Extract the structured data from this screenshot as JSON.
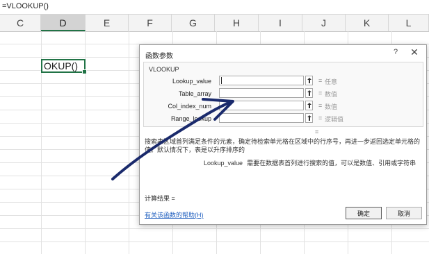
{
  "formula_bar": {
    "text": "=VLOOKUP()"
  },
  "columns": [
    "C",
    "D",
    "E",
    "F",
    "G",
    "H",
    "I",
    "J",
    "K",
    "L"
  ],
  "selected_column": "D",
  "active_cell": {
    "text": "OKUP()"
  },
  "dialog": {
    "title": "函数参数",
    "help_icon": "?",
    "close_icon": "✕",
    "function_name": "VLOOKUP",
    "args": [
      {
        "label": "Lookup_value",
        "eq": "=",
        "hint": "任意"
      },
      {
        "label": "Table_array",
        "eq": "=",
        "hint": "数值"
      },
      {
        "label": "Col_index_num",
        "eq": "=",
        "hint": "数值"
      },
      {
        "label": "Range_lookup",
        "eq": "=",
        "hint": "逻辑值"
      }
    ],
    "result_eq": "=",
    "description": "搜索表区域首列满足条件的元素，确定待检索单元格在区域中的行序号，再进一步返回选定单元格的值。默认情况下，表是以升序排序的",
    "param_name": "Lookup_value",
    "param_description": "需要在数据表首列进行搜索的值，可以是数值、引用或字符串",
    "calc_result": "计算结果 =",
    "help_link": "有关该函数的帮助(H)",
    "ok_label": "确定",
    "cancel_label": "取消"
  },
  "colors": {
    "accent": "#217346",
    "link": "#1f5fbf",
    "annotation_ink": "#1a2a6c"
  }
}
